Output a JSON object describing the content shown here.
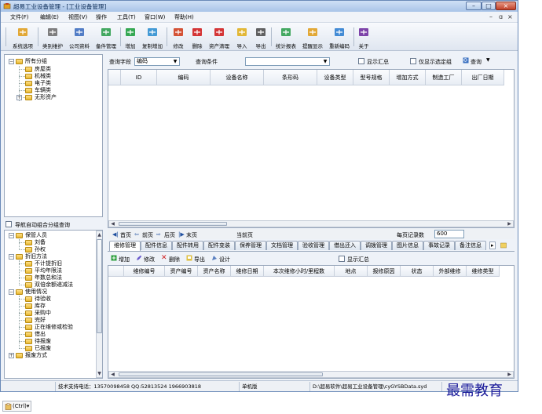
{
  "window": {
    "title": "超易工业设备管理 - [工业设备管理]",
    "controls": {
      "minimize": "–",
      "maximize": "□",
      "close": "×"
    }
  },
  "menu": {
    "items": [
      "文件(F)",
      "编辑(E)",
      "视图(V)",
      "操作",
      "工具(T)",
      "窗口(W)",
      "帮助(H)"
    ],
    "mdi_controls": [
      "–",
      "ɑ",
      "×"
    ]
  },
  "toolbar": {
    "buttons": [
      {
        "label": "系统选项",
        "icon": "options-icon",
        "color": "#e0a020"
      },
      {
        "label": "类别维护",
        "icon": "tools-icon",
        "color": "#707070"
      },
      {
        "label": "公司资料",
        "icon": "company-icon",
        "color": "#4070c0"
      },
      {
        "label": "备件管理",
        "icon": "parts-icon",
        "color": "#30a050"
      },
      {
        "label": "增加",
        "icon": "add-icon",
        "color": "#20a040"
      },
      {
        "label": "复制增加",
        "icon": "copy-add-icon",
        "color": "#3090d0"
      },
      {
        "label": "修改",
        "icon": "edit-icon",
        "color": "#d04020"
      },
      {
        "label": "删除",
        "icon": "delete-icon",
        "color": "#d02020"
      },
      {
        "label": "资产清理",
        "icon": "clear-icon",
        "color": "#d02020"
      },
      {
        "label": "导入",
        "icon": "import-icon",
        "color": "#e0b020"
      },
      {
        "label": "导出",
        "icon": "export-icon",
        "color": "#505050"
      },
      {
        "label": "统计报表",
        "icon": "report-icon",
        "color": "#30a050"
      },
      {
        "label": "提醒显示",
        "icon": "reminder-icon",
        "color": "#e0a020"
      },
      {
        "label": "重新编码",
        "icon": "recode-icon",
        "color": "#3080d0"
      },
      {
        "label": "关于",
        "icon": "help-icon",
        "color": "#7030a0"
      }
    ]
  },
  "tree_top": {
    "root": "所有分组",
    "children": [
      "房屋类",
      "机械类",
      "电子类",
      "车辆类",
      "无形资产"
    ]
  },
  "nav_checkbox": "导航自动组合分组查询",
  "tree_bottom": {
    "groups": [
      {
        "label": "保管人员",
        "children": [
          "刘备",
          "孙权"
        ]
      },
      {
        "label": "折旧方法",
        "children": [
          "不计提折旧",
          "平均年限法",
          "年数总和法",
          "双倍余额递减法"
        ]
      },
      {
        "label": "使用情况",
        "children": [
          "待验收",
          "库存",
          "采购中",
          "完好",
          "正在维修或检验",
          "借出",
          "待报废",
          "已报废"
        ]
      },
      {
        "label": "报废方式",
        "children": []
      }
    ]
  },
  "query": {
    "field_label": "查询字段",
    "field_value": "编码",
    "condition_label": "查询条件",
    "condition_value": "",
    "show_summary": "显示汇总",
    "only_selected": "仅显示选定组",
    "query_button": "查询"
  },
  "main_table": {
    "columns": [
      "ID",
      "编码",
      "设备名称",
      "条形码",
      "设备类型",
      "型号规格",
      "增加方式",
      "制造工厂",
      "出厂日期"
    ]
  },
  "pager": {
    "first": "首页",
    "prev": "前页",
    "next": "后页",
    "last": "末页",
    "current_label": "当前页",
    "per_page_label": "每页记录数",
    "per_page_value": "600"
  },
  "detail_tabs": [
    "维修管理",
    "配件信息",
    "配件转用",
    "配件变装",
    "保养管理",
    "文档管理",
    "验收管理",
    "借出还入",
    "调拨管理",
    "图片信息",
    "事故记录",
    "备注信息"
  ],
  "detail_toolbar": {
    "add": "增加",
    "edit": "修改",
    "delete": "删除",
    "export": "导出",
    "design": "设计",
    "show_summary": "显示汇总"
  },
  "detail_table": {
    "columns": [
      "维修编号",
      "资产编号",
      "资产名称",
      "维修日期",
      "本次维修小时/里程数",
      "地点",
      "报修原因",
      "状态",
      "外部维修",
      "维修类型"
    ]
  },
  "statusbar": {
    "support": "技术支持电话：13570098458 QQ:52813524 1966903818",
    "edition": "单机版",
    "path": "D:\\超易软件\\超易工业设备管理\\cyGYSBData.syd"
  },
  "watermark": "最需教育",
  "ctrl_badge": "(Ctrl)▾"
}
